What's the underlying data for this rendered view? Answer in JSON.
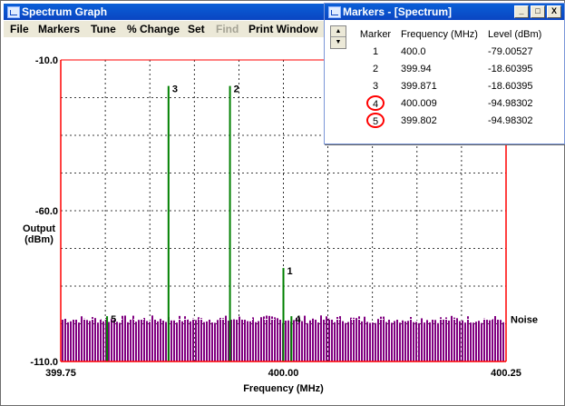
{
  "app": {
    "title": "Spectrum Graph",
    "menu": [
      "File",
      "Markers",
      "Tune",
      "% Change",
      "Set",
      "Find",
      "Print Window"
    ],
    "menu_disabled": [
      "Find"
    ]
  },
  "markers_window": {
    "title": "Markers - [Spectrum]",
    "controls": {
      "minimize": "_",
      "maximize": "□",
      "close": "X"
    },
    "columns": [
      "Marker",
      "Frequency (MHz)",
      "Level (dBm)"
    ],
    "rows": [
      {
        "marker": "1",
        "frequency": "400.0",
        "level": "-79.00527"
      },
      {
        "marker": "2",
        "frequency": "399.94",
        "level": "-18.60395"
      },
      {
        "marker": "3",
        "frequency": "399.871",
        "level": "-18.60395"
      },
      {
        "marker": "4",
        "frequency": "400.009",
        "level": "-94.98302"
      },
      {
        "marker": "5",
        "frequency": "399.802",
        "level": "-94.98302"
      }
    ],
    "highlighted_markers": [
      "4",
      "5"
    ]
  },
  "chart_data": {
    "type": "line",
    "xlabel": "Frequency (MHz)",
    "ylabel": "Output (dBm)",
    "xlim": [
      399.75,
      400.25
    ],
    "ylim": [
      -110,
      -10
    ],
    "x_tick_labels": [
      "399.75",
      "400.00",
      "400.25"
    ],
    "y_tick_labels": [
      "-10.0",
      "-60.0",
      "-110.0"
    ],
    "grid": true,
    "noise_label": "Noise",
    "noise_level": -96,
    "series": [
      {
        "name": "markers",
        "points": [
          {
            "label": "1",
            "x": 400.0,
            "y": -79.00527
          },
          {
            "label": "2",
            "x": 399.94,
            "y": -18.60395
          },
          {
            "label": "3",
            "x": 399.871,
            "y": -18.60395
          },
          {
            "label": "4",
            "x": 400.009,
            "y": -94.98302
          },
          {
            "label": "5",
            "x": 399.802,
            "y": -94.98302
          }
        ]
      }
    ],
    "colors": {
      "signal": "#008000",
      "noise": "#800080",
      "axis": "#ff0000",
      "grid": "#000000",
      "marker_circle": "#ff0000"
    }
  }
}
